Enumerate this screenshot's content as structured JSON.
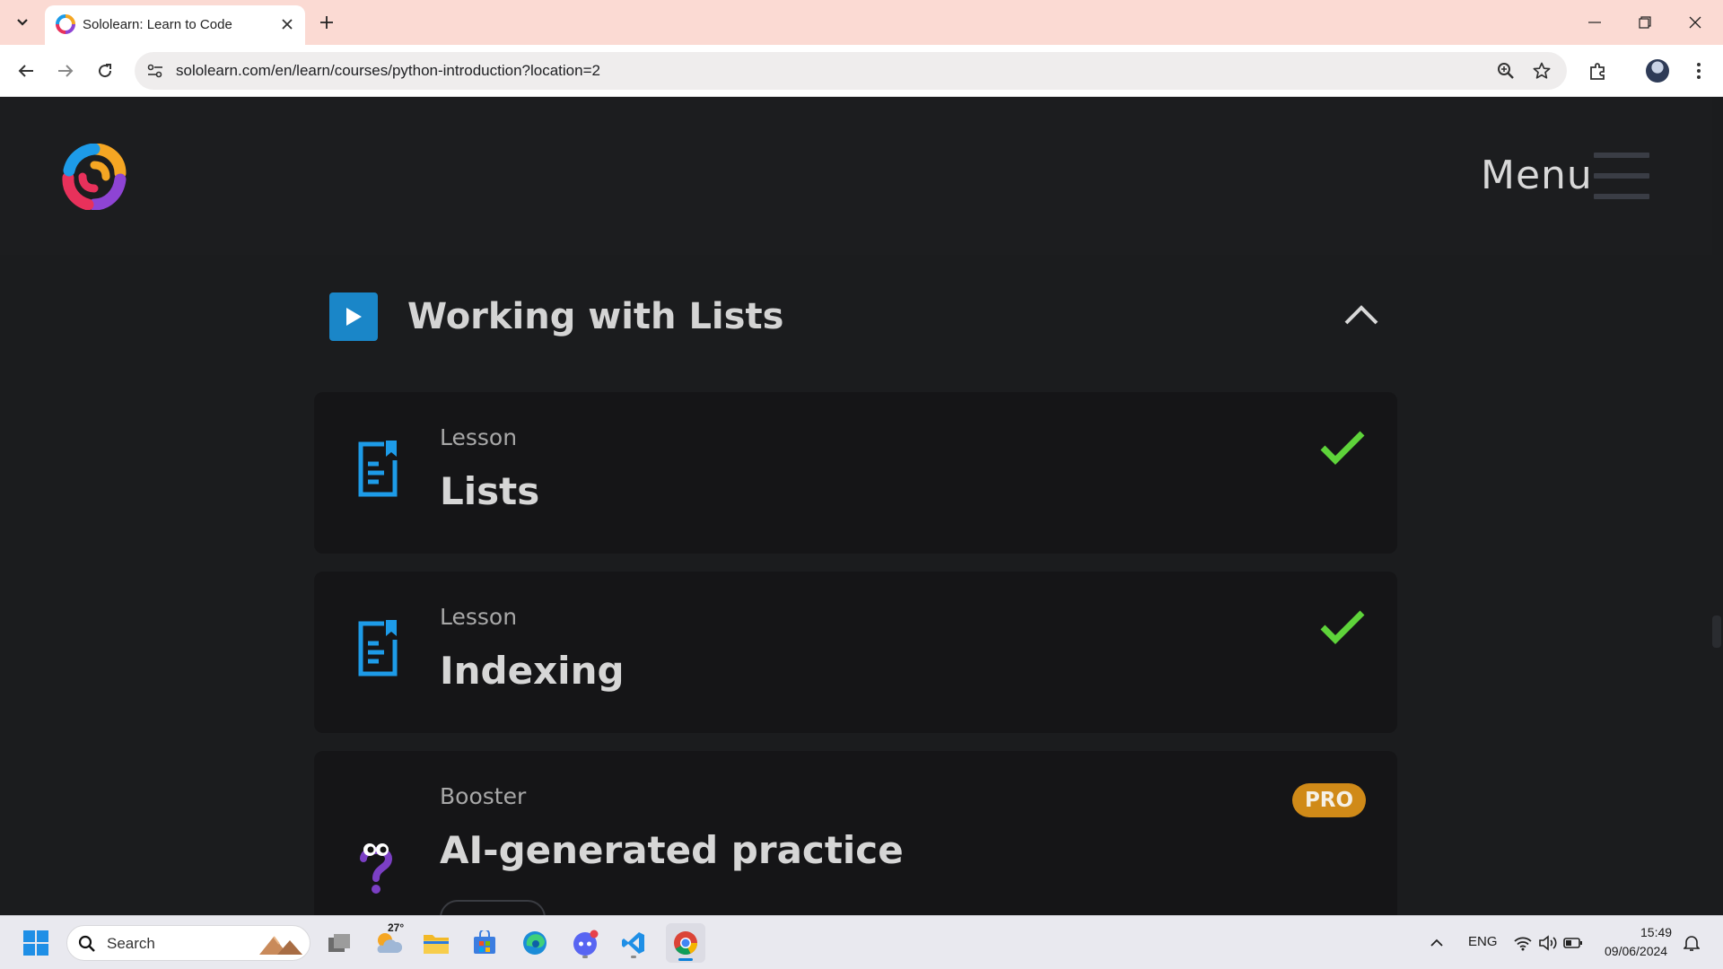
{
  "browser": {
    "tab_title": "Sololearn: Learn to Code",
    "url": "sololearn.com/en/learn/courses/python-introduction?location=2"
  },
  "header": {
    "menu_label": "Menu"
  },
  "module": {
    "title": "Working with Lists",
    "items": [
      {
        "type": "Lesson",
        "title": "Lists",
        "status": "completed"
      },
      {
        "type": "Lesson",
        "title": "Indexing",
        "status": "completed"
      },
      {
        "type": "Booster",
        "title": "AI-generated practice",
        "badge": "PRO"
      }
    ]
  },
  "colors": {
    "accent_blue": "#1a86c8",
    "check_green": "#5ed33a",
    "pro_orange": "#d08a18",
    "booster_purple": "#7b3fc4"
  },
  "taskbar": {
    "search_placeholder": "Search",
    "weather_temp": "27°",
    "language": "ENG",
    "time": "15:49",
    "date": "09/06/2024"
  }
}
